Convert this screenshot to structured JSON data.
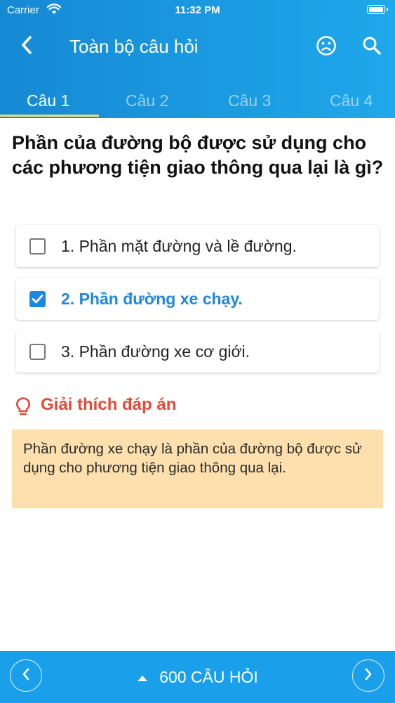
{
  "status_bar": {
    "carrier": "Carrier",
    "time": "11:32 PM"
  },
  "header": {
    "title": "Toàn bộ câu hỏi",
    "back_icon": "chevron-left-icon",
    "face_icon": "sad-face-icon",
    "search_icon": "search-icon"
  },
  "tabs": [
    {
      "label": "Câu 1",
      "active": true
    },
    {
      "label": "Câu 2",
      "active": false
    },
    {
      "label": "Câu 3",
      "active": false
    },
    {
      "label": "Câu 4",
      "active": false
    }
  ],
  "question": {
    "text": "Phần của đường bộ được sử dụng cho các phương tiện giao thông qua lại là gì?"
  },
  "answers": [
    {
      "text": "1. Phần mặt đường và lề đường.",
      "checked": false
    },
    {
      "text": "2. Phần đường xe chạy.",
      "checked": true
    },
    {
      "text": "3. Phần đường xe cơ giới.",
      "checked": false
    }
  ],
  "explanation": {
    "title": "Giải thích đáp án",
    "text": "Phần đường xe chạy là phần của đường bộ được sử dụng cho phương tiện giao thông qua lại."
  },
  "bottom_bar": {
    "counter_label": "600 CÂU HỎI"
  },
  "colors": {
    "header_gradient_start": "#1689d4",
    "header_gradient_end": "#1fa8eb",
    "tab_indicator": "#f3e06a",
    "correct_answer": "#1e86de",
    "explanation_title": "#e34a3c",
    "explanation_background": "#fde0ae",
    "bottom_bar": "#1a9fea"
  }
}
